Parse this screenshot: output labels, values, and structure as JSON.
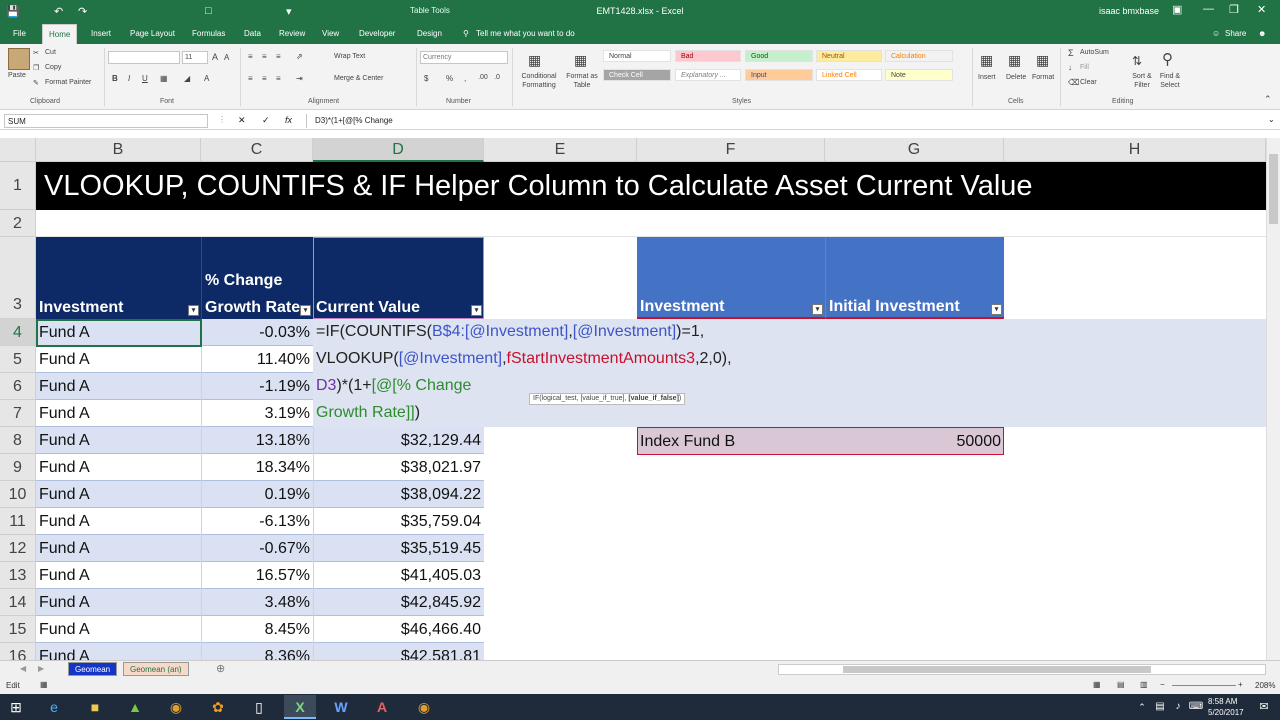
{
  "title_bar": {
    "filename": "EMT1428.xlsx - Excel",
    "context": "Table Tools",
    "user": "isaac bmxbase"
  },
  "tabs": [
    "File",
    "Home",
    "Insert",
    "Page Layout",
    "Formulas",
    "Data",
    "Review",
    "Developer",
    "Design"
  ],
  "tell_me": "Tell me what you want to do",
  "share": "Share",
  "ribbon": {
    "paste": "Paste",
    "cut": "Cut",
    "copy": "Copy",
    "format_painter": "Format Painter",
    "font_size": "11",
    "wrap_text": "Wrap Text",
    "merge_center": "Merge & Center",
    "number_format": "Currency",
    "conditional": "Conditional Formatting",
    "format_as": "Format as Table",
    "styles": [
      "Normal",
      "Bad",
      "Good",
      "Neutral",
      "Calculation",
      "Check Cell",
      "Explanatory ...",
      "Input",
      "Linked Cell",
      "Note"
    ],
    "insert": "Insert",
    "delete": "Delete",
    "format": "Format",
    "autosum": "AutoSum",
    "fill": "Fill",
    "clear": "Clear",
    "sort_filter": "Sort & Filter",
    "find_select": "Find & Select",
    "groups": [
      "Clipboard",
      "Font",
      "Alignment",
      "Number",
      "Styles",
      "Cells",
      "Editing"
    ]
  },
  "name_box": "SUM",
  "formula_bar": "D3)*(1+[@[% Change",
  "columns": [
    "B",
    "C",
    "D",
    "E",
    "F",
    "G",
    "H"
  ],
  "rows": [
    "1",
    "2",
    "3",
    "4",
    "5",
    "6",
    "7",
    "8",
    "9",
    "10",
    "11",
    "12",
    "13",
    "14",
    "15",
    "16"
  ],
  "sheet_title": "VLOOKUP, COUNTIFS & IF Helper Column to Calculate Asset Current Value",
  "table_headers": {
    "investment": "Investment",
    "change_line1": "% Change",
    "change_line2": "Growth Rate",
    "current_value": "Current Value"
  },
  "table_rows": [
    {
      "investment": "Fund A",
      "change": "-0.03%",
      "value": ""
    },
    {
      "investment": "Fund A",
      "change": "11.40%",
      "value": ""
    },
    {
      "investment": "Fund A",
      "change": "-1.19%",
      "value": ""
    },
    {
      "investment": "Fund A",
      "change": "3.19%",
      "value": ""
    },
    {
      "investment": "Fund A",
      "change": "13.18%",
      "value": "$32,129.44"
    },
    {
      "investment": "Fund A",
      "change": "18.34%",
      "value": "$38,021.97"
    },
    {
      "investment": "Fund A",
      "change": "0.19%",
      "value": "$38,094.22"
    },
    {
      "investment": "Fund A",
      "change": "-6.13%",
      "value": "$35,759.04"
    },
    {
      "investment": "Fund A",
      "change": "-0.67%",
      "value": "$35,519.45"
    },
    {
      "investment": "Fund A",
      "change": "16.57%",
      "value": "$41,405.03"
    },
    {
      "investment": "Fund A",
      "change": "3.48%",
      "value": "$42,845.92"
    },
    {
      "investment": "Fund A",
      "change": "8.45%",
      "value": "$46,466.40"
    },
    {
      "investment": "Fund A",
      "change": "8.36%",
      "value": "$42,581.81"
    }
  ],
  "formula_lines": {
    "l1_a": "=IF(COUNTIFS(",
    "l1_b": "B$4:[@Investment]",
    "l1_c": ",",
    "l1_d": "[@Investment]",
    "l1_e": ")=1,",
    "l2_a": "VLOOKUP(",
    "l2_b": "[@Investment]",
    "l2_c": ",",
    "l2_d": "fStartInvestmentAmounts3",
    "l2_e": ",2,0),",
    "l3_a": "D3",
    "l3_b": ")*(1+",
    "l3_c": "[@[% Change",
    "l4_a": "Growth Rate]]",
    "l4_b": ")"
  },
  "tooltip": {
    "a": "IF(logical_test, [value_if_true], ",
    "b": "[value_if_false]",
    "c": ")"
  },
  "lookup_table": {
    "header_investment": "Investment",
    "header_initial": "Initial Investment",
    "row_name": "Index Fund B",
    "row_value": "50000"
  },
  "sheet_tabs": [
    "Geomean",
    "Geomean (an)"
  ],
  "status": {
    "mode": "Edit",
    "zoom": "208%",
    "time": "8:58 AM",
    "date": "5/20/2017"
  },
  "colors": {
    "excel_green": "#217346",
    "header_navy": "#0d2a66",
    "header_blue": "#4472c4",
    "band_light": "#d9e1f2",
    "ref_blue": "#3d55c9",
    "ref_red": "#c8102e",
    "ref_purple": "#7030a0",
    "ref_green": "#2e8b2e"
  }
}
